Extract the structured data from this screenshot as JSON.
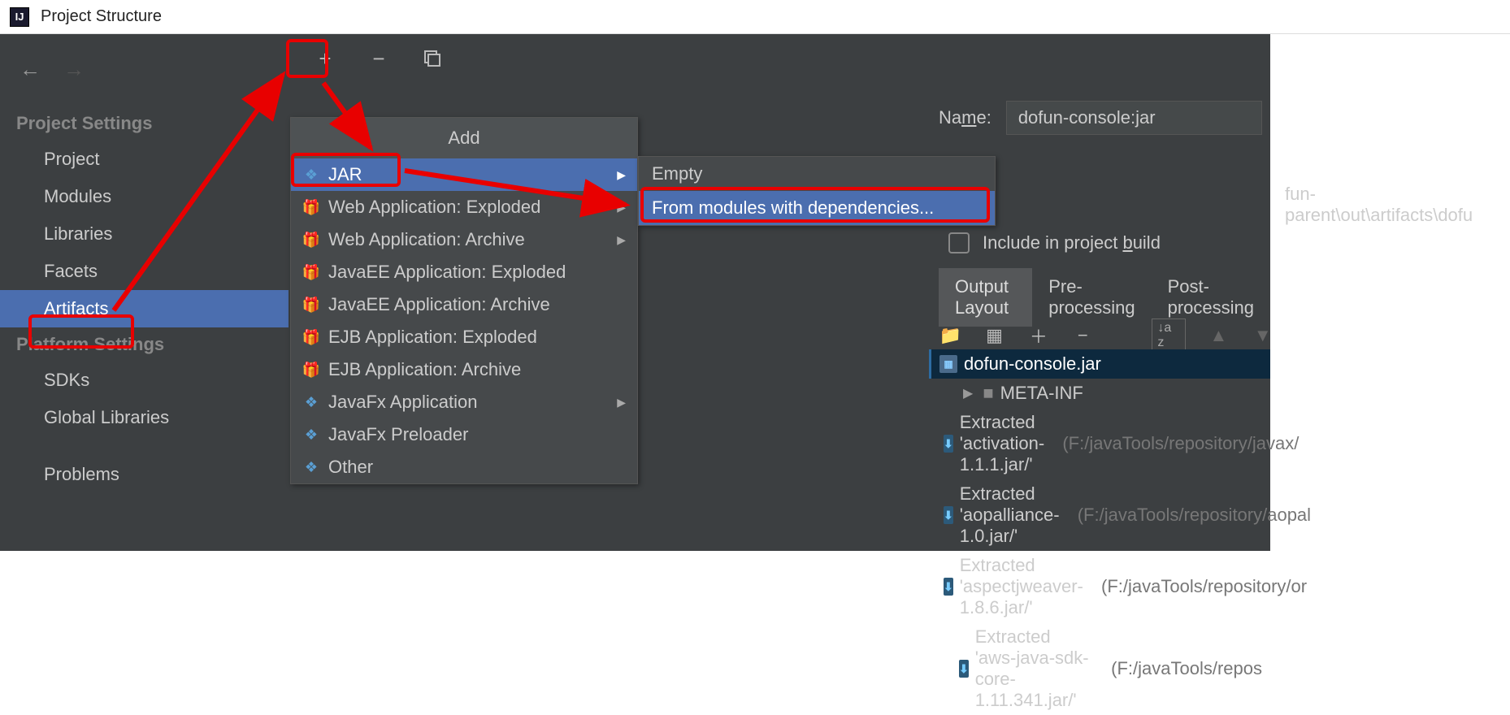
{
  "window": {
    "title": "Project Structure",
    "app_initials": "IJ"
  },
  "sidebar": {
    "section1": "Project Settings",
    "items1": [
      "Project",
      "Modules",
      "Libraries",
      "Facets",
      "Artifacts"
    ],
    "section2": "Platform Settings",
    "items2": [
      "SDKs",
      "Global Libraries"
    ],
    "problems": "Problems"
  },
  "toolbar": {
    "add": "+",
    "remove": "−",
    "copy": "⧉"
  },
  "name_field": {
    "label_prefix": "Na",
    "label_u": "m",
    "label_suffix": "e:",
    "value": "dofun-console:jar"
  },
  "output_path_fragment": "fun-parent\\out\\artifacts\\dofu",
  "include": {
    "prefix": "Include in project ",
    "u": "b",
    "suffix": "uild"
  },
  "tabs": {
    "t1": "Output Layout",
    "t2": "Pre-processing",
    "t3": "Post-processing"
  },
  "layout_toolbar": {
    "sort": "↓a z"
  },
  "tree": {
    "root": "dofun-console.jar",
    "meta": "META-INF",
    "e1a": "Extracted 'activation-1.1.1.jar/'",
    "e1b": "(F:/javaTools/repository/javax/",
    "e2a": "Extracted 'aopalliance-1.0.jar/'",
    "e2b": "(F:/javaTools/repository/aopal",
    "e3a": "Extracted 'aspectjweaver-1.8.6.jar/'",
    "e3b": "(F:/javaTools/repository/or",
    "e4a": "Extracted 'aws-java-sdk-core-1.11.341.jar/'",
    "e4b": "(F:/javaTools/repos"
  },
  "add_menu": {
    "title": "Add",
    "items": [
      "JAR",
      "Web Application: Exploded",
      "Web Application: Archive",
      "JavaEE Application: Exploded",
      "JavaEE Application: Archive",
      "EJB Application: Exploded",
      "EJB Application: Archive",
      "JavaFx Application",
      "JavaFx Preloader",
      "Other"
    ]
  },
  "sub_menu": {
    "i1": "Empty",
    "i2": "From modules with dependencies..."
  }
}
